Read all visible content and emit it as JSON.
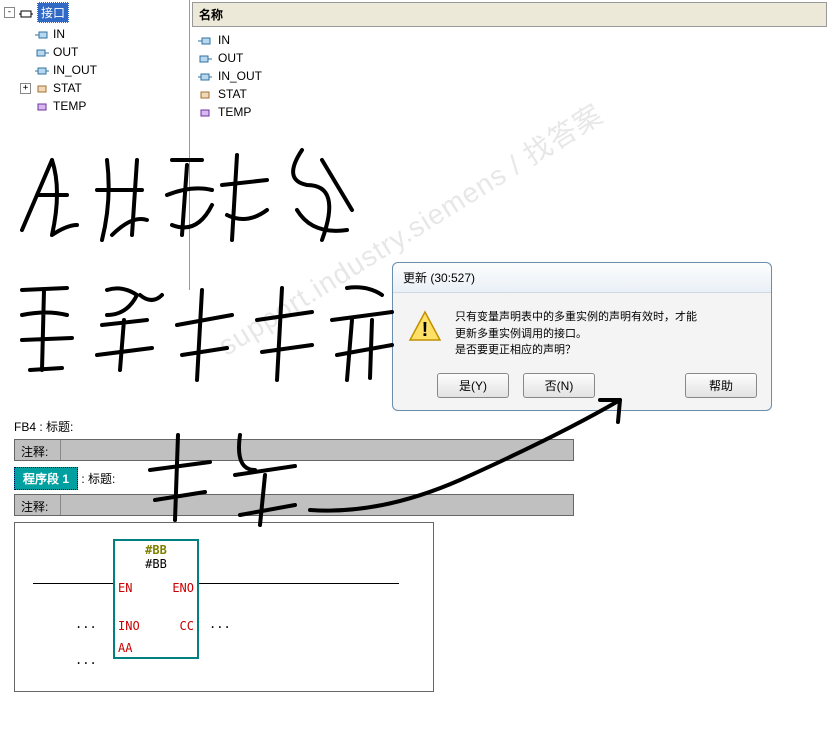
{
  "tree": {
    "rootLabel": "接口",
    "items": [
      "IN",
      "OUT",
      "IN_OUT",
      "STAT",
      "TEMP"
    ]
  },
  "rightHeader": "名称",
  "paramList": [
    "IN",
    "OUT",
    "IN_OUT",
    "STAT",
    "TEMP"
  ],
  "block": {
    "header": "FB4 : 标题:",
    "commentLabel": "注释:",
    "netLabel": "程序段 1",
    "netTitle": ": 标题:",
    "fbTitle": "#BB",
    "fbSub": "#BB",
    "ports": {
      "en": "EN",
      "eno": "ENO",
      "ino": "INO",
      "cc": "CC",
      "aa": "AA"
    },
    "stub": "..."
  },
  "dialog": {
    "title": "更新 (30:527)",
    "line1": "只有变量声明表中的多重实例的声明有效时，才能",
    "line2": "更新多重实例调用的接口。",
    "line3": "是否要更正相应的声明？",
    "yes": "是(Y)",
    "no": "否(N)",
    "help": "帮助"
  },
  "watermark": "support.industry.siemens / 找答案"
}
